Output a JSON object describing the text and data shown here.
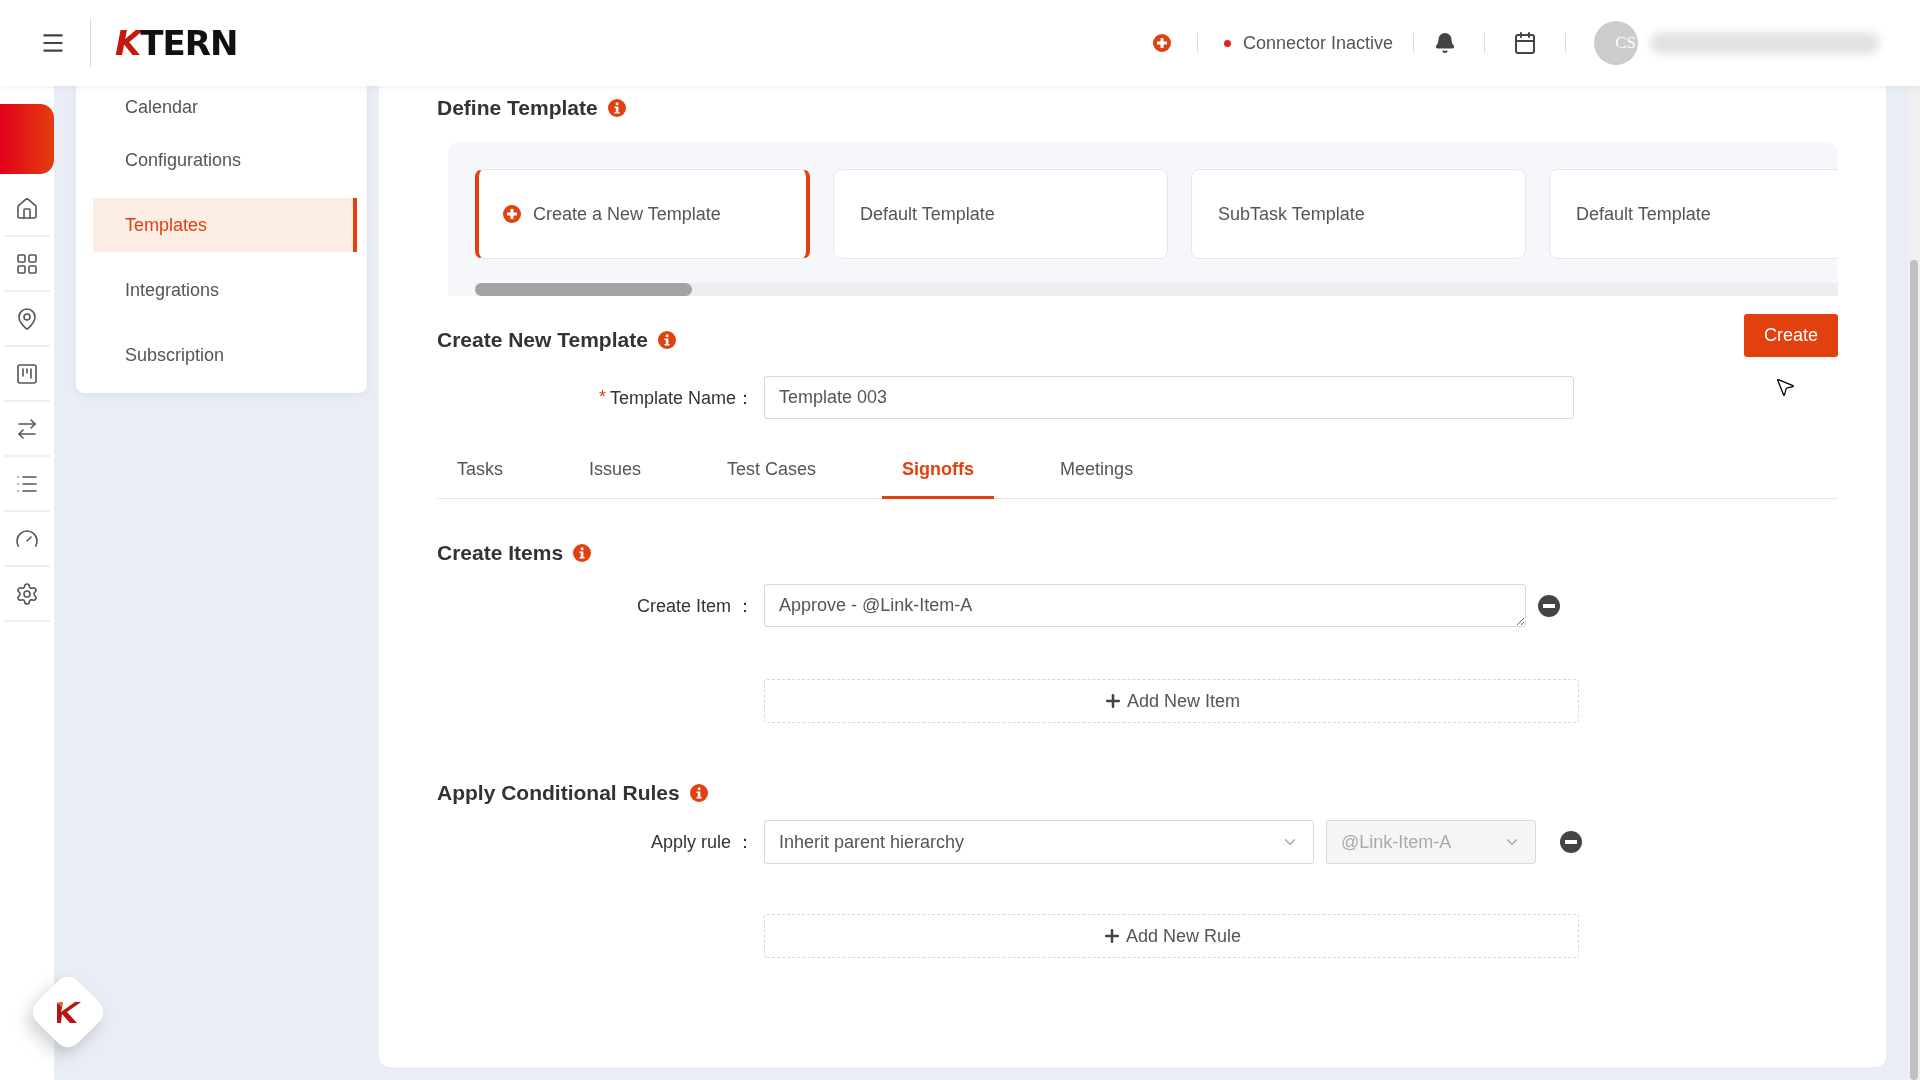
{
  "header": {
    "logo": {
      "mark": "K",
      "text": "TERN"
    },
    "connector": {
      "label": "Connector Inactive",
      "color": "#e5231b"
    },
    "avatar": {
      "initials": "CS"
    }
  },
  "submenu": {
    "items": [
      {
        "label": "Calendar",
        "selected": false
      },
      {
        "label": "Configurations",
        "selected": false
      },
      {
        "label": "Templates",
        "selected": true
      },
      {
        "label": "Integrations",
        "selected": false
      },
      {
        "label": "Subscription",
        "selected": false
      }
    ]
  },
  "define_template": {
    "title": "Define Template",
    "cards": [
      {
        "label": "Create a New Template",
        "kind": "create",
        "selected": true
      },
      {
        "label": "Default Template",
        "kind": "template",
        "selected": false
      },
      {
        "label": "SubTask Template",
        "kind": "template",
        "selected": false
      },
      {
        "label": "Default Template",
        "kind": "template",
        "selected": false
      }
    ]
  },
  "create_new_template": {
    "title": "Create New Template",
    "button": "Create",
    "template_name": {
      "required_mark": "*",
      "label": "Template Name：",
      "value": "Template 003"
    }
  },
  "tabs": [
    {
      "label": "Tasks",
      "selected": false
    },
    {
      "label": "Issues",
      "selected": false
    },
    {
      "label": "Test Cases",
      "selected": false
    },
    {
      "label": "Signoffs",
      "selected": true
    },
    {
      "label": "Meetings",
      "selected": false
    }
  ],
  "create_items": {
    "title": "Create Items",
    "rows": [
      {
        "label": "Create Item ：",
        "value": "Approve - @Link-Item-A"
      }
    ],
    "add_button": "Add New Item"
  },
  "conditional_rules": {
    "title": "Apply Conditional Rules",
    "rows": [
      {
        "label": "Apply rule ：",
        "rule": {
          "value": "Inherit parent hierarchy",
          "disabled": false
        },
        "link": {
          "value": "@Link-Item-A",
          "disabled": true
        }
      }
    ],
    "add_button": "Add New Rule"
  }
}
